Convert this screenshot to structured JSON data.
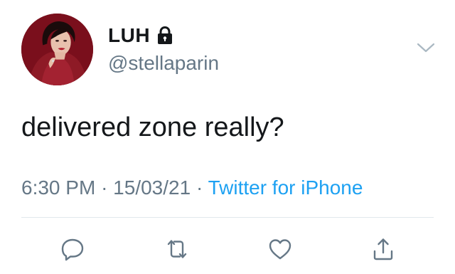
{
  "tweet": {
    "display_name": "LUH",
    "username": "@stellaparin",
    "text": "delivered zone really?",
    "time": "6:30 PM",
    "date": "15/03/21",
    "separator": "·",
    "source": "Twitter for iPhone"
  },
  "icons": {
    "lock": "lock-icon",
    "menu": "chevron-down-icon",
    "reply": "reply-icon",
    "retweet": "retweet-icon",
    "like": "heart-icon",
    "share": "share-icon"
  },
  "colors": {
    "text": "#14171a",
    "secondary": "#657786",
    "link": "#1da1f2",
    "divider": "#e1e8ed"
  }
}
